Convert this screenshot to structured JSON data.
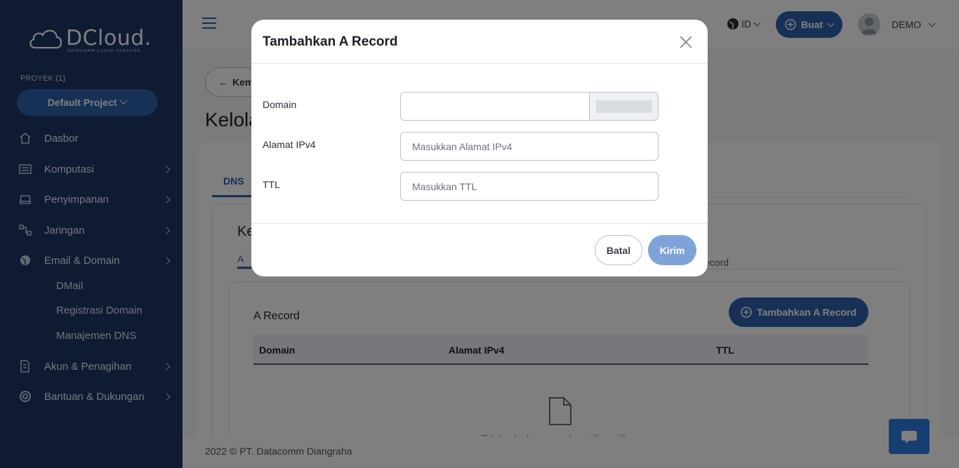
{
  "sidebar": {
    "brand": "DCloud.",
    "brand_sub": "DATACOMM CLOUD SERVICES",
    "project_label": "PROYEK (1)",
    "project_selected": "Default Project",
    "items": [
      {
        "label": "Dasbor",
        "icon": "home-icon"
      },
      {
        "label": "Komputasi",
        "icon": "server-icon"
      },
      {
        "label": "Penyimpanan",
        "icon": "drive-icon"
      },
      {
        "label": "Jaringan",
        "icon": "network-icon"
      },
      {
        "label": "Email & Domain",
        "icon": "globe-icon"
      },
      {
        "label": "Akun & Penagihan",
        "icon": "invoice-icon"
      },
      {
        "label": "Bantuan & Dukungan",
        "icon": "lifebuoy-icon"
      }
    ],
    "subitems": [
      "DMail",
      "Registrasi Domain",
      "Manajemen DNS"
    ]
  },
  "header": {
    "language": "ID",
    "create_label": "Buat",
    "user_name": "DEMO"
  },
  "main": {
    "back_label": "Kem",
    "page_title": "Kelola",
    "tab_active": "DNS",
    "inner_title": "Ke",
    "subtab_active": "A",
    "subtab_other": "ecord",
    "record_title": "A Record",
    "add_button": "Tambahkan A Record",
    "columns": [
      "Domain",
      "Alamat IPv4",
      "TTL"
    ],
    "empty_text": "Tidak ada data yang dapat ditampilkan"
  },
  "footer": {
    "copyright": "2022 © PT. Datacomm Diangraha"
  },
  "modal": {
    "title": "Tambahkan A Record",
    "fields": {
      "domain_label": "Domain",
      "domain_value": "",
      "ipv4_label": "Alamat IPv4",
      "ipv4_placeholder": "Masukkan Alamat IPv4",
      "ttl_label": "TTL",
      "ttl_placeholder": "Masukkan TTL"
    },
    "cancel_label": "Batal",
    "submit_label": "Kirim"
  },
  "colors": {
    "sidebar_bg": "#1f3767",
    "primary": "#2f63ad",
    "submit_disabled": "#7ea3d8",
    "chat_button": "#2f7de1"
  }
}
